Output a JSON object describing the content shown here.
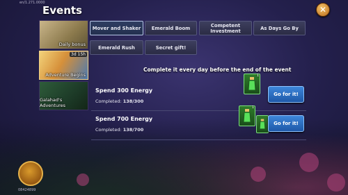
{
  "version": "en/1.271.0000",
  "title": "Events",
  "close_icon": "close-icon",
  "side_events": [
    {
      "label": "Daily bonus",
      "selected": false
    },
    {
      "label": "Adventure Begins",
      "selected": true,
      "timer": "3d 15h"
    },
    {
      "label": "Galahad's Adventures",
      "selected": false
    }
  ],
  "tabs": [
    {
      "label": "Mover and Shaker",
      "active": true
    },
    {
      "label": "Emerald Boom",
      "active": false
    },
    {
      "label": "Competent Investment",
      "active": false
    },
    {
      "label": "As Days Go By",
      "active": false
    },
    {
      "label": "Emerald Rush",
      "active": false
    },
    {
      "label": "Secret gift!",
      "active": false
    }
  ],
  "headline": "Complete it every day before the end of the event",
  "tasks": [
    {
      "name": "Spend 300 Energy",
      "completed_label": "Completed:",
      "completed": "138/300",
      "reward_qty": "1",
      "button": "Go for it!"
    },
    {
      "name": "Spend 700 Energy",
      "completed_label": "Completed:",
      "completed": "138/700",
      "reward_qty": "1",
      "button": "Go for it!"
    }
  ],
  "player_id": "08424899",
  "colors": {
    "accent_blue": "#2f73c8",
    "reward_green": "#2f7c2b",
    "gold": "#e6b24a"
  }
}
